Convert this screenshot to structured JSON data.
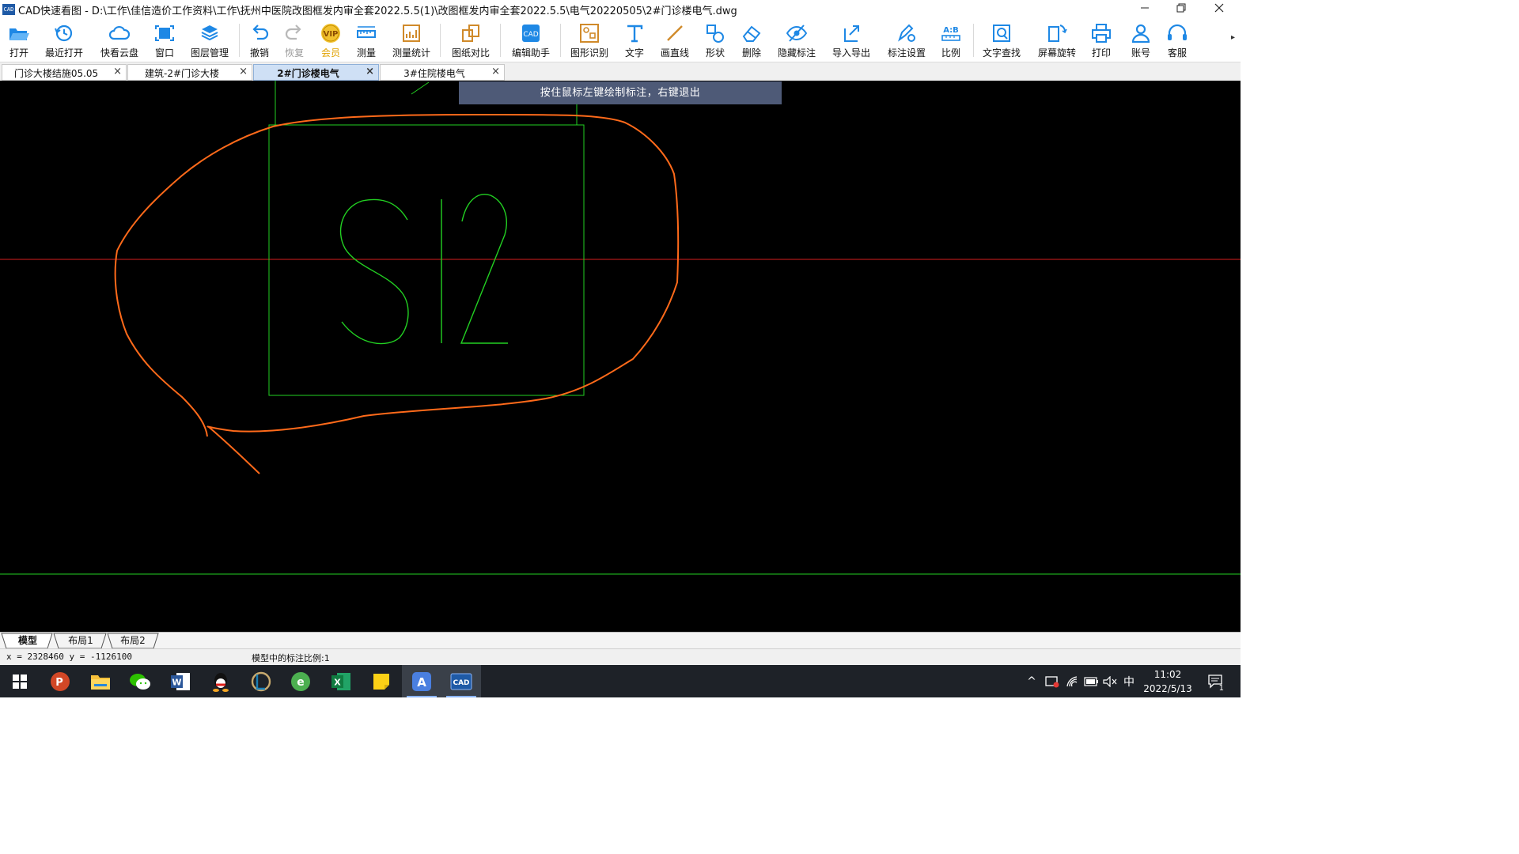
{
  "title_bar": {
    "app_logo": "CAD",
    "title": "CAD快速看图 - D:\\工作\\佳信造价工作资料\\工作\\抚州中医院改图框发内审全套2022.5.5(1)\\改图框发内审全套2022.5.5\\电气20220505\\2#门诊楼电气.dwg",
    "minimize_icon": "minimize-icon",
    "restore_icon": "restore-icon",
    "close_icon": "close-icon"
  },
  "toolbar": {
    "items": [
      {
        "label": "打开",
        "icon": "folder-open-icon"
      },
      {
        "label": "最近打开",
        "icon": "history-icon"
      },
      {
        "label": "快看云盘",
        "icon": "cloud-icon"
      },
      {
        "label": "窗口",
        "icon": "window-icon"
      },
      {
        "label": "图层管理",
        "icon": "layers-icon"
      },
      {
        "label": "撤销",
        "icon": "undo-icon"
      },
      {
        "label": "恢复",
        "icon": "redo-icon"
      },
      {
        "label": "会员",
        "icon": "vip-icon",
        "badge": "VIP"
      },
      {
        "label": "测量",
        "icon": "measure-icon"
      },
      {
        "label": "测量统计",
        "icon": "measure-stats-icon"
      },
      {
        "label": "图纸对比",
        "icon": "compare-icon"
      },
      {
        "label": "编辑助手",
        "icon": "edit-assistant-icon"
      },
      {
        "label": "图形识别",
        "icon": "shape-recognize-icon"
      },
      {
        "label": "文字",
        "icon": "text-icon"
      },
      {
        "label": "画直线",
        "icon": "line-icon"
      },
      {
        "label": "形状",
        "icon": "shape-icon"
      },
      {
        "label": "删除",
        "icon": "eraser-icon"
      },
      {
        "label": "隐藏标注",
        "icon": "hide-annotation-icon"
      },
      {
        "label": "导入导出",
        "icon": "import-export-icon"
      },
      {
        "label": "标注设置",
        "icon": "annotation-settings-icon"
      },
      {
        "label": "比例",
        "icon": "scale-icon",
        "badge": "A:B"
      },
      {
        "label": "文字查找",
        "icon": "text-search-icon"
      },
      {
        "label": "屏幕旋转",
        "icon": "rotate-screen-icon"
      },
      {
        "label": "打印",
        "icon": "printer-icon"
      },
      {
        "label": "账号",
        "icon": "account-icon"
      },
      {
        "label": "客服",
        "icon": "headset-icon"
      }
    ],
    "more_icon": "more-arrow-icon"
  },
  "tabs": [
    {
      "label": "门诊大楼结施05.05",
      "active": false
    },
    {
      "label": "建筑-2#门诊大楼",
      "active": false
    },
    {
      "label": "2#门诊楼电气",
      "active": true
    },
    {
      "label": "3#住院楼电气",
      "active": false
    }
  ],
  "tab_close_glyph": "×",
  "canvas": {
    "hint": "按住鼠标左键绘制标注，右键退出",
    "drawing_text": "S12",
    "colors": {
      "background": "#000000",
      "drawing_green": "#22d022",
      "axis_red": "#d81e1e",
      "annotation_orange": "#ff6a1a"
    }
  },
  "layout_tabs": [
    {
      "label": "模型",
      "active": true
    },
    {
      "label": "布局1",
      "active": false
    },
    {
      "label": "布局2",
      "active": false
    }
  ],
  "status_bar": {
    "coordinates": "x = 2328460 y = -1126100",
    "scale_text": "模型中的标注比例:1"
  },
  "taskbar": {
    "apps": [
      {
        "name": "windows-start-icon",
        "label": "开始"
      },
      {
        "name": "powerpoint-icon",
        "label": "P"
      },
      {
        "name": "file-explorer-icon",
        "label": ""
      },
      {
        "name": "wechat-icon",
        "label": ""
      },
      {
        "name": "word-icon",
        "label": "W"
      },
      {
        "name": "qq-icon",
        "label": ""
      },
      {
        "name": "league-icon",
        "label": ""
      },
      {
        "name": "browser-icon",
        "label": "e"
      },
      {
        "name": "excel-icon",
        "label": "X"
      },
      {
        "name": "sticky-notes-icon",
        "label": ""
      },
      {
        "name": "drawing-app-icon",
        "label": "A"
      },
      {
        "name": "cad-viewer-icon",
        "label": "CAD"
      }
    ],
    "tray": {
      "chevron": "^",
      "ime": "中",
      "time": "11:02",
      "date": "2022/5/13",
      "notification_count": "1"
    }
  }
}
